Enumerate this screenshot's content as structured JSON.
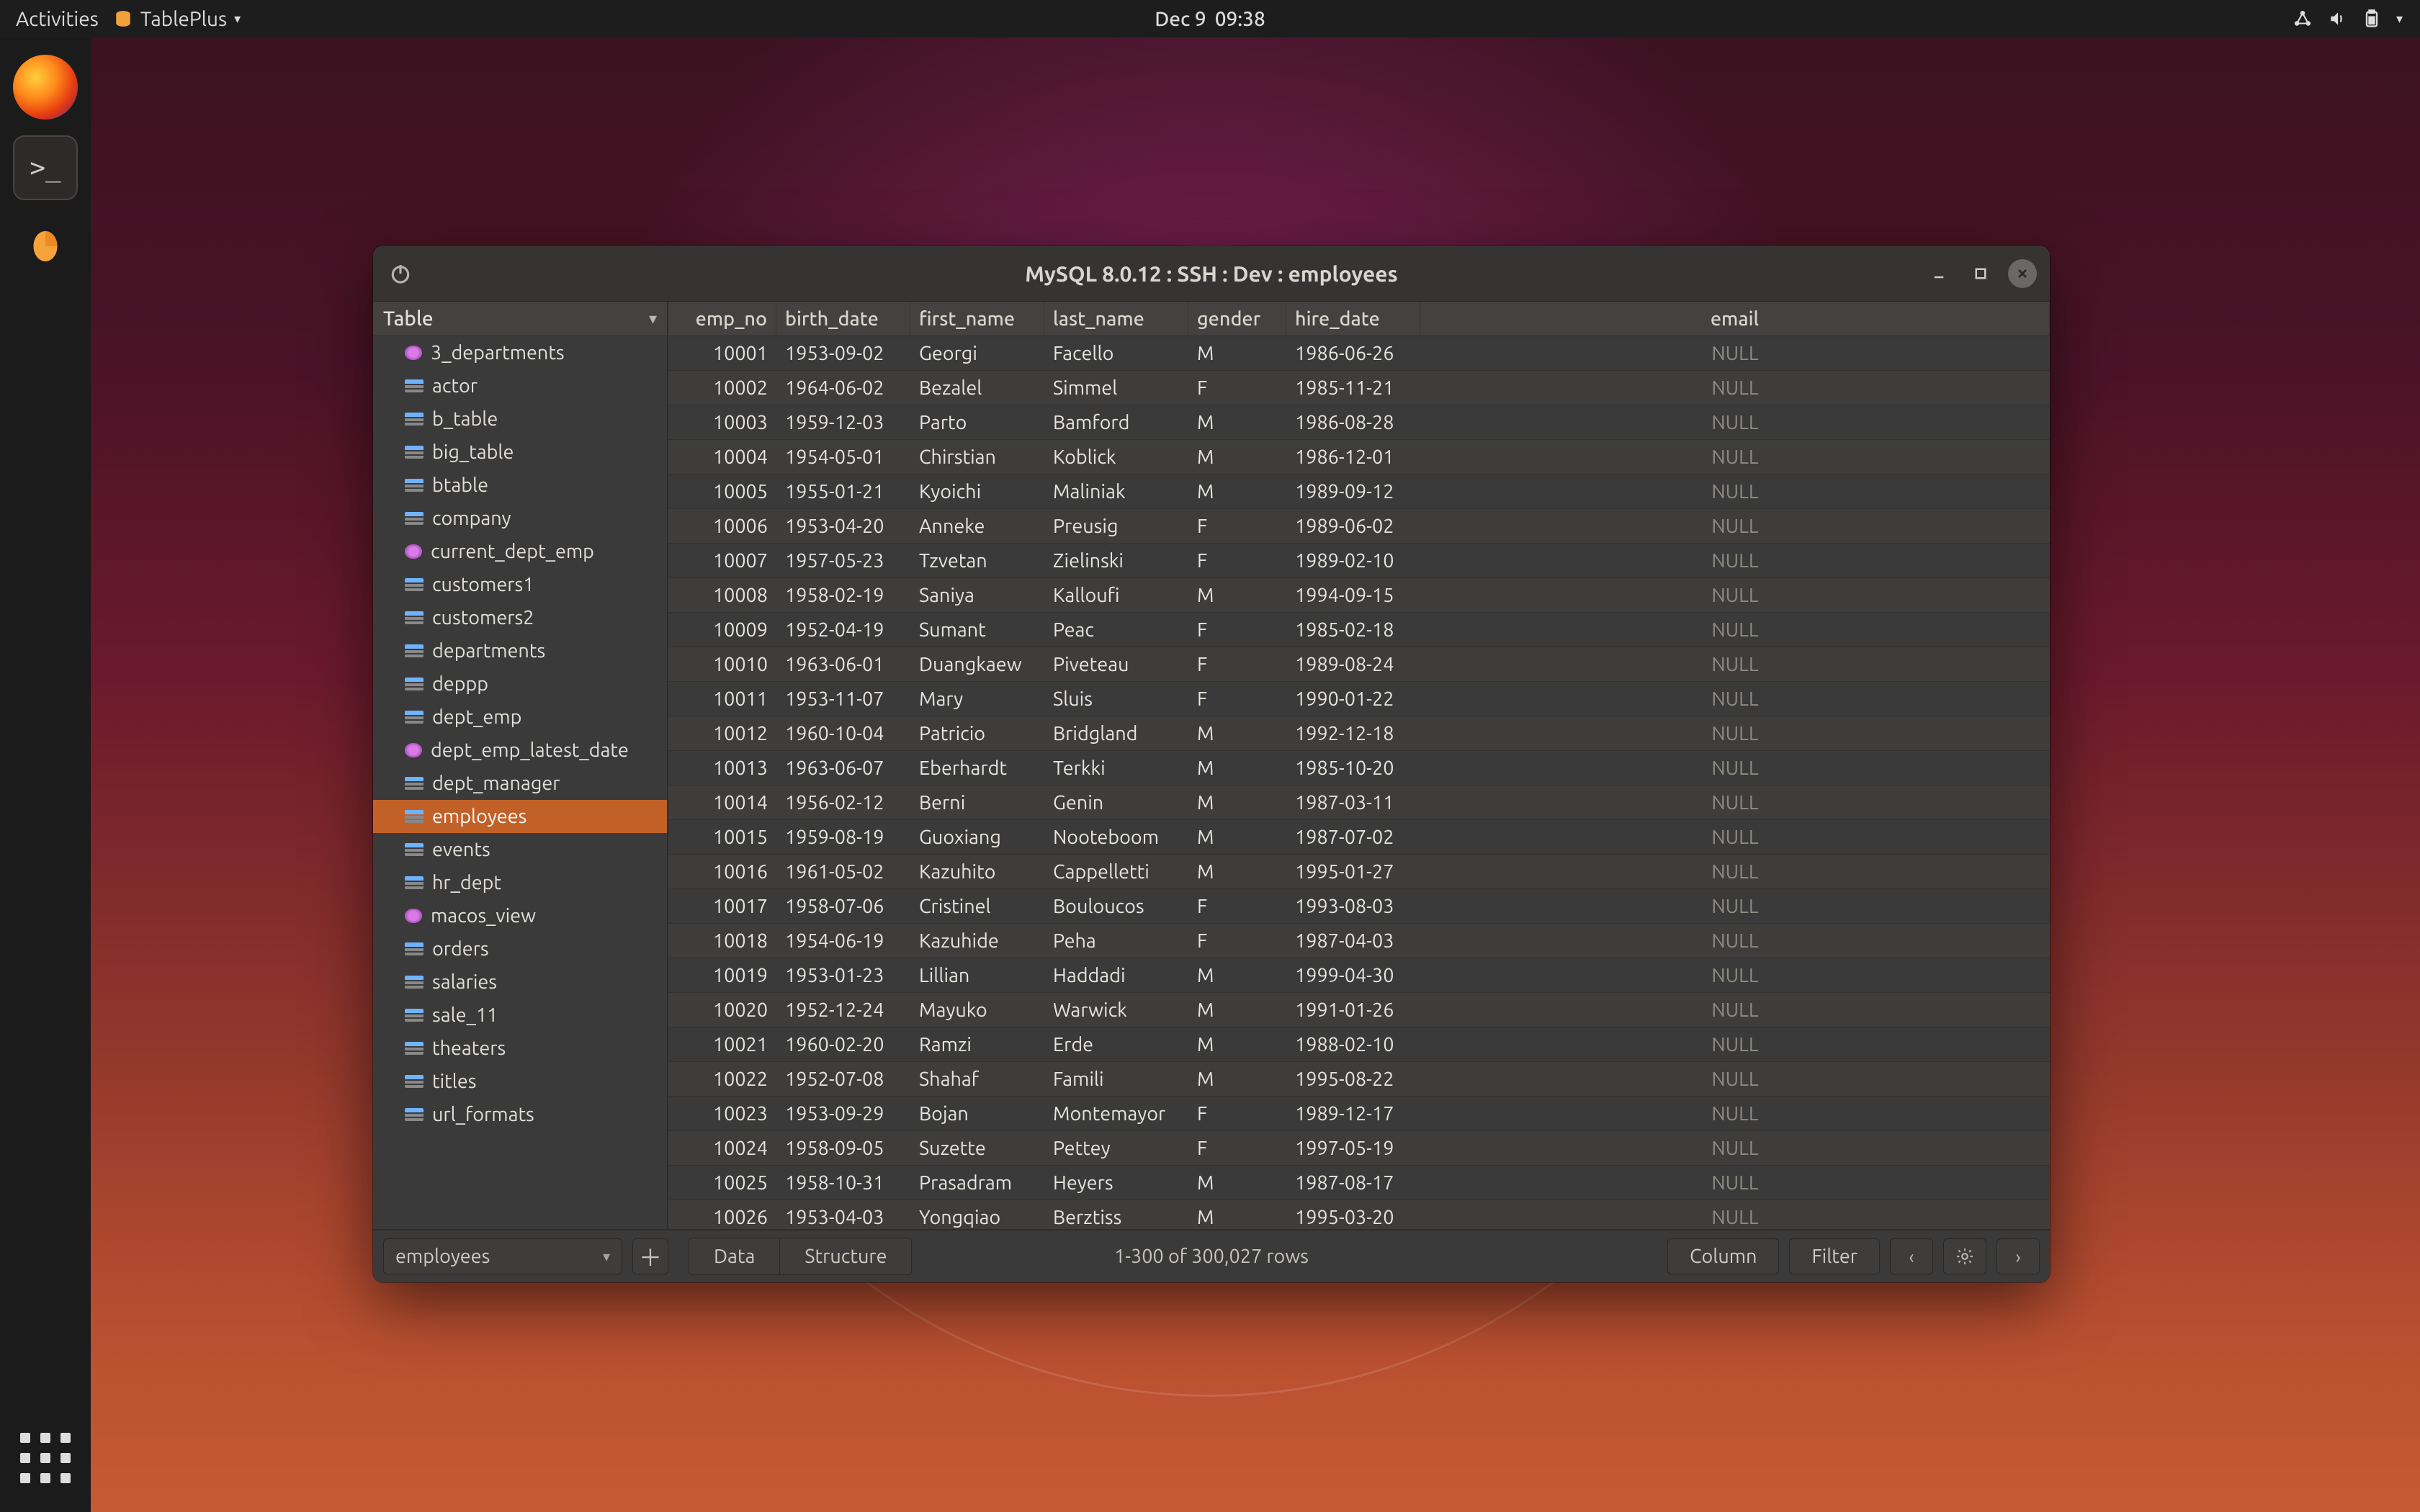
{
  "panel": {
    "activities": "Activities",
    "app_name": "TablePlus",
    "date": "Dec 9",
    "time": "09:38"
  },
  "window": {
    "title": "MySQL 8.0.12  :  SSH  :  Dev  :  employees"
  },
  "sidebar": {
    "header": "Table",
    "items": [
      {
        "name": "3_departments",
        "type": "view"
      },
      {
        "name": "actor",
        "type": "table"
      },
      {
        "name": "b_table",
        "type": "table"
      },
      {
        "name": "big_table",
        "type": "table"
      },
      {
        "name": "btable",
        "type": "table"
      },
      {
        "name": "company",
        "type": "table"
      },
      {
        "name": "current_dept_emp",
        "type": "view"
      },
      {
        "name": "customers1",
        "type": "table"
      },
      {
        "name": "customers2",
        "type": "table"
      },
      {
        "name": "departments",
        "type": "table"
      },
      {
        "name": "deppp",
        "type": "table"
      },
      {
        "name": "dept_emp",
        "type": "table"
      },
      {
        "name": "dept_emp_latest_date",
        "type": "view"
      },
      {
        "name": "dept_manager",
        "type": "table"
      },
      {
        "name": "employees",
        "type": "table",
        "selected": true
      },
      {
        "name": "events",
        "type": "table"
      },
      {
        "name": "hr_dept",
        "type": "table"
      },
      {
        "name": "macos_view",
        "type": "view"
      },
      {
        "name": "orders",
        "type": "table"
      },
      {
        "name": "salaries",
        "type": "table"
      },
      {
        "name": "sale_11",
        "type": "table"
      },
      {
        "name": "theaters",
        "type": "table"
      },
      {
        "name": "titles",
        "type": "table"
      },
      {
        "name": "url_formats",
        "type": "table"
      }
    ]
  },
  "columns": [
    "emp_no",
    "birth_date",
    "first_name",
    "last_name",
    "gender",
    "hire_date",
    "email"
  ],
  "rows": [
    {
      "emp_no": "10001",
      "birth_date": "1953-09-02",
      "first_name": "Georgi",
      "last_name": "Facello",
      "gender": "M",
      "hire_date": "1986-06-26",
      "email": null
    },
    {
      "emp_no": "10002",
      "birth_date": "1964-06-02",
      "first_name": "Bezalel",
      "last_name": "Simmel",
      "gender": "F",
      "hire_date": "1985-11-21",
      "email": null
    },
    {
      "emp_no": "10003",
      "birth_date": "1959-12-03",
      "first_name": "Parto",
      "last_name": "Bamford",
      "gender": "M",
      "hire_date": "1986-08-28",
      "email": null
    },
    {
      "emp_no": "10004",
      "birth_date": "1954-05-01",
      "first_name": "Chirstian",
      "last_name": "Koblick",
      "gender": "M",
      "hire_date": "1986-12-01",
      "email": null
    },
    {
      "emp_no": "10005",
      "birth_date": "1955-01-21",
      "first_name": "Kyoichi",
      "last_name": "Maliniak",
      "gender": "M",
      "hire_date": "1989-09-12",
      "email": null
    },
    {
      "emp_no": "10006",
      "birth_date": "1953-04-20",
      "first_name": "Anneke",
      "last_name": "Preusig",
      "gender": "F",
      "hire_date": "1989-06-02",
      "email": null
    },
    {
      "emp_no": "10007",
      "birth_date": "1957-05-23",
      "first_name": "Tzvetan",
      "last_name": "Zielinski",
      "gender": "F",
      "hire_date": "1989-02-10",
      "email": null
    },
    {
      "emp_no": "10008",
      "birth_date": "1958-02-19",
      "first_name": "Saniya",
      "last_name": "Kalloufi",
      "gender": "M",
      "hire_date": "1994-09-15",
      "email": null
    },
    {
      "emp_no": "10009",
      "birth_date": "1952-04-19",
      "first_name": "Sumant",
      "last_name": "Peac",
      "gender": "F",
      "hire_date": "1985-02-18",
      "email": null
    },
    {
      "emp_no": "10010",
      "birth_date": "1963-06-01",
      "first_name": "Duangkaew",
      "last_name": "Piveteau",
      "gender": "F",
      "hire_date": "1989-08-24",
      "email": null
    },
    {
      "emp_no": "10011",
      "birth_date": "1953-11-07",
      "first_name": "Mary",
      "last_name": "Sluis",
      "gender": "F",
      "hire_date": "1990-01-22",
      "email": null
    },
    {
      "emp_no": "10012",
      "birth_date": "1960-10-04",
      "first_name": "Patricio",
      "last_name": "Bridgland",
      "gender": "M",
      "hire_date": "1992-12-18",
      "email": null
    },
    {
      "emp_no": "10013",
      "birth_date": "1963-06-07",
      "first_name": "Eberhardt",
      "last_name": "Terkki",
      "gender": "M",
      "hire_date": "1985-10-20",
      "email": null
    },
    {
      "emp_no": "10014",
      "birth_date": "1956-02-12",
      "first_name": "Berni",
      "last_name": "Genin",
      "gender": "M",
      "hire_date": "1987-03-11",
      "email": null
    },
    {
      "emp_no": "10015",
      "birth_date": "1959-08-19",
      "first_name": "Guoxiang",
      "last_name": "Nooteboom",
      "gender": "M",
      "hire_date": "1987-07-02",
      "email": null
    },
    {
      "emp_no": "10016",
      "birth_date": "1961-05-02",
      "first_name": "Kazuhito",
      "last_name": "Cappelletti",
      "gender": "M",
      "hire_date": "1995-01-27",
      "email": null
    },
    {
      "emp_no": "10017",
      "birth_date": "1958-07-06",
      "first_name": "Cristinel",
      "last_name": "Bouloucos",
      "gender": "F",
      "hire_date": "1993-08-03",
      "email": null
    },
    {
      "emp_no": "10018",
      "birth_date": "1954-06-19",
      "first_name": "Kazuhide",
      "last_name": "Peha",
      "gender": "F",
      "hire_date": "1987-04-03",
      "email": null
    },
    {
      "emp_no": "10019",
      "birth_date": "1953-01-23",
      "first_name": "Lillian",
      "last_name": "Haddadi",
      "gender": "M",
      "hire_date": "1999-04-30",
      "email": null
    },
    {
      "emp_no": "10020",
      "birth_date": "1952-12-24",
      "first_name": "Mayuko",
      "last_name": "Warwick",
      "gender": "M",
      "hire_date": "1991-01-26",
      "email": null
    },
    {
      "emp_no": "10021",
      "birth_date": "1960-02-20",
      "first_name": "Ramzi",
      "last_name": "Erde",
      "gender": "M",
      "hire_date": "1988-02-10",
      "email": null
    },
    {
      "emp_no": "10022",
      "birth_date": "1952-07-08",
      "first_name": "Shahaf",
      "last_name": "Famili",
      "gender": "M",
      "hire_date": "1995-08-22",
      "email": null
    },
    {
      "emp_no": "10023",
      "birth_date": "1953-09-29",
      "first_name": "Bojan",
      "last_name": "Montemayor",
      "gender": "F",
      "hire_date": "1989-12-17",
      "email": null
    },
    {
      "emp_no": "10024",
      "birth_date": "1958-09-05",
      "first_name": "Suzette",
      "last_name": "Pettey",
      "gender": "F",
      "hire_date": "1997-05-19",
      "email": null
    },
    {
      "emp_no": "10025",
      "birth_date": "1958-10-31",
      "first_name": "Prasadram",
      "last_name": "Heyers",
      "gender": "M",
      "hire_date": "1987-08-17",
      "email": null
    },
    {
      "emp_no": "10026",
      "birth_date": "1953-04-03",
      "first_name": "Yongqiao",
      "last_name": "Berztiss",
      "gender": "M",
      "hire_date": "1995-03-20",
      "email": null
    }
  ],
  "footer": {
    "selected_table": "employees",
    "tab_data": "Data",
    "tab_structure": "Structure",
    "status": "1-300 of 300,027 rows",
    "column_btn": "Column",
    "filter_btn": "Filter"
  },
  "null_text": "NULL"
}
